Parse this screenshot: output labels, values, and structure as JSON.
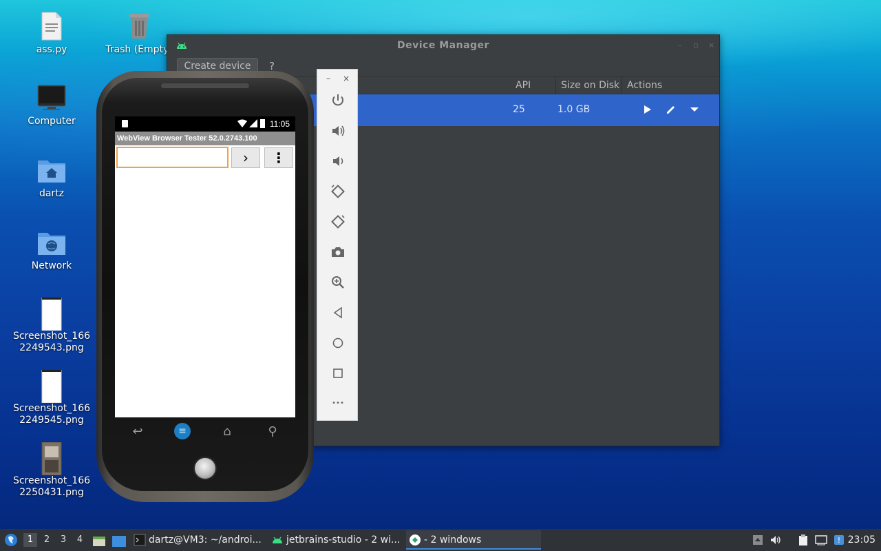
{
  "desktop": {
    "icons": [
      {
        "label": "ass.py",
        "icon": "python-file-icon"
      },
      {
        "label": "Trash (Empty)",
        "icon": "trash-icon"
      },
      {
        "label": "Computer",
        "icon": "computer-icon"
      },
      {
        "label": "dartz",
        "icon": "home-folder-icon"
      },
      {
        "label": "Network",
        "icon": "network-folder-icon"
      },
      {
        "label": "Screenshot_166\n2249543.png",
        "icon": "image-file-icon"
      },
      {
        "label": "Screenshot_166\n2249545.png",
        "icon": "image-file-icon"
      },
      {
        "label": "Screenshot_166\n2250431.png",
        "icon": "image-file-icon"
      }
    ],
    "label_0": "ass.py",
    "label_1": "Trash (Empty)",
    "label_2": "Computer",
    "label_3": "dartz",
    "label_4": "Network",
    "label_5a": "Screenshot_166",
    "label_5b": "2249543.png",
    "label_6a": "Screenshot_166",
    "label_6b": "2249545.png",
    "label_7a": "Screenshot_166",
    "label_7b": "2250431.png"
  },
  "device_manager": {
    "title": "Device Manager",
    "create_button": "Create device",
    "help": "?",
    "columns": {
      "api": "API",
      "size": "Size on Disk",
      "actions": "Actions"
    },
    "rows": [
      {
        "api": "25",
        "size": "1.0 GB"
      }
    ],
    "accent_color": "#2f65ca"
  },
  "emulator_toolbar": {
    "minimize": "–",
    "close": "×",
    "buttons": [
      "power-icon",
      "volume-up-icon",
      "volume-down-icon",
      "rotate-left-icon",
      "rotate-right-icon",
      "camera-icon",
      "zoom-icon",
      "back-icon",
      "home-icon",
      "overview-icon",
      "more-icon"
    ],
    "more_label": "•••"
  },
  "phone": {
    "status_time": "11:05",
    "app_title": "WebView Browser Tester 52.0.2743.100",
    "url_value": "",
    "go_label": "›",
    "menu_label": "⋮",
    "url_border_color": "#f0a24a"
  },
  "taskbar": {
    "workspaces": [
      "1",
      "2",
      "3",
      "4"
    ],
    "active_workspace": "1",
    "tasks": [
      {
        "label": "dartz@VM3: ~/androi...",
        "icon": "terminal-icon"
      },
      {
        "label": "jetbrains-studio - 2 wi...",
        "icon": "android-icon"
      },
      {
        "label": "- 2 windows",
        "icon": "emulator-icon"
      }
    ],
    "clock": "23:05"
  }
}
